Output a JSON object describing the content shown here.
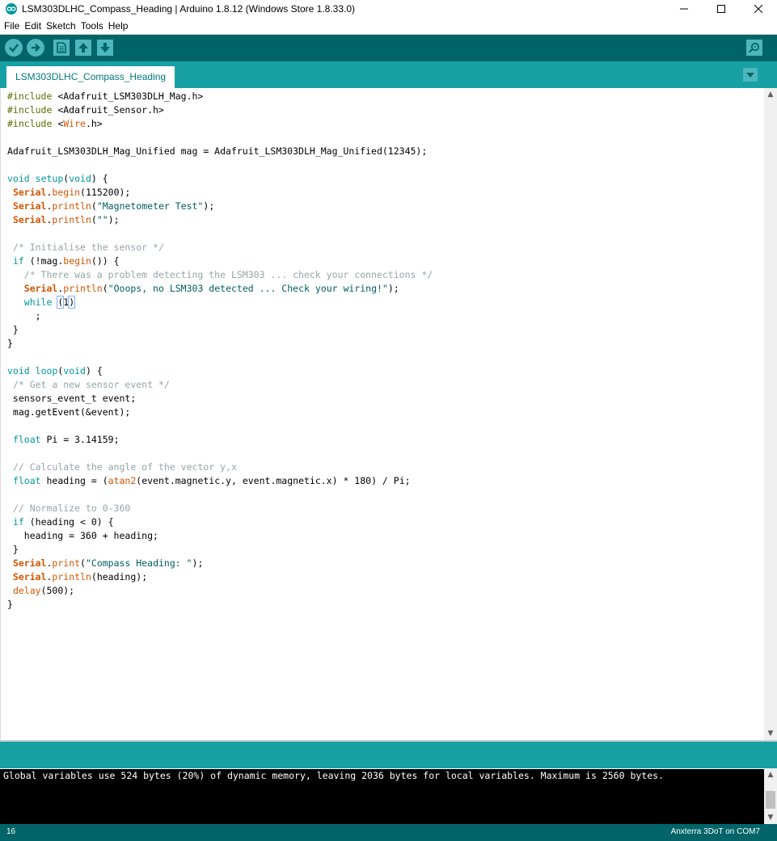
{
  "window": {
    "title": "LSM303DLHC_Compass_Heading | Arduino 1.8.12 (Windows Store 1.8.33.0)",
    "minimize_glyph": "—",
    "maximize_glyph": "☐",
    "close_glyph": "✕"
  },
  "menu": [
    "File",
    "Edit",
    "Sketch",
    "Tools",
    "Help"
  ],
  "toolbar": {
    "buttons": [
      {
        "name": "verify-button",
        "icon": "checkmark-icon"
      },
      {
        "name": "upload-button",
        "icon": "right-arrow-icon"
      },
      {
        "name": "new-button",
        "icon": "document-icon"
      },
      {
        "name": "open-button",
        "icon": "up-arrow-icon"
      },
      {
        "name": "save-button",
        "icon": "down-arrow-icon"
      }
    ],
    "serial_monitor_icon": "magnifier-icon"
  },
  "tabs": [
    {
      "label": "LSM303DLHC_Compass_Heading",
      "active": true
    }
  ],
  "editor": {
    "code": [
      [
        [
          "pp",
          "#include "
        ],
        [
          "",
          "<Adafruit_LSM303DLH_Mag.h>"
        ]
      ],
      [
        [
          "pp",
          "#include "
        ],
        [
          "",
          "<Adafruit_Sensor.h>"
        ]
      ],
      [
        [
          "pp",
          "#include "
        ],
        [
          "",
          "<"
        ],
        [
          "lib",
          "Wire"
        ],
        [
          "",
          ".h>"
        ]
      ],
      [],
      [
        [
          "",
          "Adafruit_LSM303DLH_Mag_Unified mag = Adafruit_LSM303DLH_Mag_Unified(12345);"
        ]
      ],
      [],
      [
        [
          "ty",
          "void"
        ],
        [
          "",
          " "
        ],
        [
          "kw",
          "setup"
        ],
        [
          "",
          "("
        ],
        [
          "ty",
          "void"
        ],
        [
          "",
          ") {"
        ]
      ],
      [
        [
          "",
          " "
        ],
        [
          "obj",
          "Serial"
        ],
        [
          "",
          "."
        ],
        [
          "fn",
          "begin"
        ],
        [
          "",
          "(115200);"
        ]
      ],
      [
        [
          "",
          " "
        ],
        [
          "obj",
          "Serial"
        ],
        [
          "",
          "."
        ],
        [
          "fn",
          "println"
        ],
        [
          "",
          "("
        ],
        [
          "str",
          "\"Magnetometer Test\""
        ],
        [
          "",
          ");"
        ]
      ],
      [
        [
          "",
          " "
        ],
        [
          "obj",
          "Serial"
        ],
        [
          "",
          "."
        ],
        [
          "fn",
          "println"
        ],
        [
          "",
          "("
        ],
        [
          "str",
          "\"\""
        ],
        [
          "",
          ");"
        ]
      ],
      [],
      [
        [
          "",
          " "
        ],
        [
          "cm",
          "/* Initialise the sensor */"
        ]
      ],
      [
        [
          "",
          " "
        ],
        [
          "kw",
          "if"
        ],
        [
          "",
          " (!mag."
        ],
        [
          "fn",
          "begin"
        ],
        [
          "",
          "()) {"
        ]
      ],
      [
        [
          "",
          "   "
        ],
        [
          "cm",
          "/* There was a problem detecting the LSM303 ... check your connections */"
        ]
      ],
      [
        [
          "",
          "   "
        ],
        [
          "obj",
          "Serial"
        ],
        [
          "",
          "."
        ],
        [
          "fn",
          "println"
        ],
        [
          "",
          "("
        ],
        [
          "str",
          "\"Ooops, no LSM303 detected ... Check your wiring!\""
        ],
        [
          "",
          ");"
        ]
      ],
      [
        [
          "",
          "   "
        ],
        [
          "kw",
          "while"
        ],
        [
          "",
          " "
        ],
        [
          "bracket",
          "("
        ],
        [
          "",
          "1"
        ],
        [
          "bracket",
          ")"
        ],
        [
          "caret",
          ""
        ]
      ],
      [
        [
          "",
          "     ;"
        ]
      ],
      [
        [
          "",
          " }"
        ]
      ],
      [
        [
          "",
          "}"
        ]
      ],
      [],
      [
        [
          "ty",
          "void"
        ],
        [
          "",
          " "
        ],
        [
          "kw",
          "loop"
        ],
        [
          "",
          "("
        ],
        [
          "ty",
          "void"
        ],
        [
          "",
          ") {"
        ]
      ],
      [
        [
          "",
          " "
        ],
        [
          "cm",
          "/* Get a new sensor event */"
        ]
      ],
      [
        [
          "",
          " sensors_event_t event;"
        ]
      ],
      [
        [
          "",
          " mag.getEvent(&event);"
        ]
      ],
      [],
      [
        [
          "",
          " "
        ],
        [
          "ty",
          "float"
        ],
        [
          "",
          " Pi = 3.14159;"
        ]
      ],
      [],
      [
        [
          "",
          " "
        ],
        [
          "cm",
          "// Calculate the angle of the vector y,x"
        ]
      ],
      [
        [
          "",
          " "
        ],
        [
          "ty",
          "float"
        ],
        [
          "",
          " heading = ("
        ],
        [
          "fn",
          "atan2"
        ],
        [
          "",
          "(event.magnetic.y, event.magnetic.x) * 180) / Pi;"
        ]
      ],
      [],
      [
        [
          "",
          " "
        ],
        [
          "cm",
          "// Normalize to 0-360"
        ]
      ],
      [
        [
          "",
          " "
        ],
        [
          "kw",
          "if"
        ],
        [
          "",
          " (heading < 0) {"
        ]
      ],
      [
        [
          "",
          "   heading = 360 + heading;"
        ]
      ],
      [
        [
          "",
          " }"
        ]
      ],
      [
        [
          "",
          " "
        ],
        [
          "obj",
          "Serial"
        ],
        [
          "",
          "."
        ],
        [
          "fn",
          "print"
        ],
        [
          "",
          "("
        ],
        [
          "str",
          "\"Compass Heading: \""
        ],
        [
          "",
          ");"
        ]
      ],
      [
        [
          "",
          " "
        ],
        [
          "obj",
          "Serial"
        ],
        [
          "",
          "."
        ],
        [
          "fn",
          "println"
        ],
        [
          "",
          "(heading);"
        ]
      ],
      [
        [
          "",
          " "
        ],
        [
          "fn",
          "delay"
        ],
        [
          "",
          "(500);"
        ]
      ],
      [
        [
          "",
          "}"
        ]
      ]
    ]
  },
  "console": {
    "text": "Global variables use 524 bytes (20%) of dynamic memory, leaving 2036 bytes for local variables. Maximum is 2560 bytes."
  },
  "status": {
    "line": "16",
    "board": "Anxterra 3DoT on COM7"
  }
}
